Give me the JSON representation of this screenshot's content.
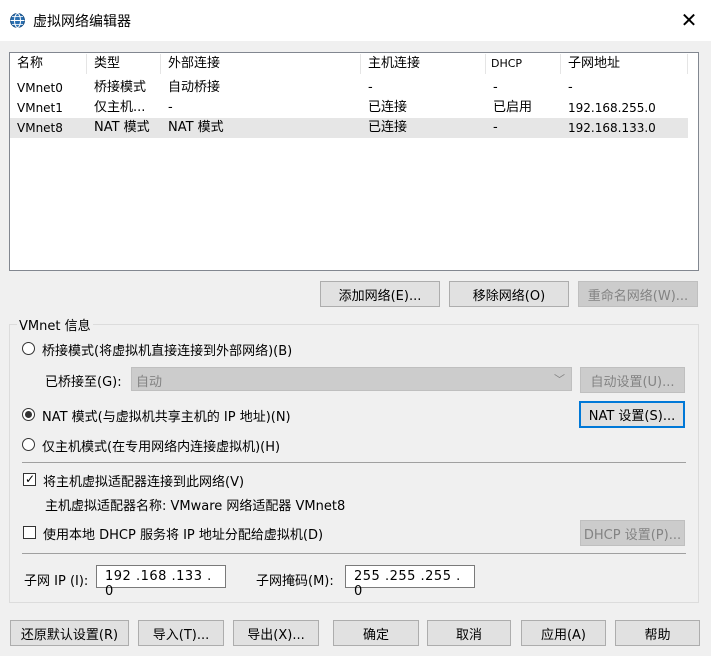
{
  "window": {
    "title": "虚拟网络编辑器",
    "close": "✕"
  },
  "table": {
    "headers": [
      "名称",
      "类型",
      "外部连接",
      "主机连接",
      "DHCP",
      "子网地址"
    ],
    "rows": [
      [
        "VMnet0",
        "桥接模式",
        "自动桥接",
        "-",
        "-",
        "-"
      ],
      [
        "VMnet1",
        "仅主机...",
        "-",
        "已连接",
        "已启用",
        "192.168.255.0"
      ],
      [
        "VMnet8",
        "NAT 模式",
        "NAT 模式",
        "已连接",
        "-",
        "192.168.133.0"
      ]
    ],
    "selected_row": 2
  },
  "network_buttons": {
    "add": "添加网络(E)...",
    "remove": "移除网络(O)",
    "rename": "重命名网络(W)..."
  },
  "vmnet_info": {
    "group_label": "VMnet 信息",
    "bridge_mode": "桥接模式(将虚拟机直接连接到外部网络)(B)",
    "bridged_to_label": "已桥接至(G):",
    "bridged_to_value": "自动",
    "auto_settings": "自动设置(U)...",
    "nat_mode": "NAT 模式(与虚拟机共享主机的 IP 地址)(N)",
    "nat_settings": "NAT 设置(S)...",
    "host_only_mode": "仅主机模式(在专用网络内连接虚拟机)(H)",
    "connect_adapter": "将主机虚拟适配器连接到此网络(V)",
    "adapter_name": "主机虚拟适配器名称: VMware 网络适配器 VMnet8",
    "use_dhcp": "使用本地 DHCP 服务将 IP 地址分配给虚拟机(D)",
    "dhcp_settings": "DHCP 设置(P)...",
    "subnet_ip_label": "子网 IP (I):",
    "subnet_ip_value": "192 .168 .133 .  0",
    "subnet_mask_label": "子网掩码(M):",
    "subnet_mask_value": "255 .255 .255 .  0",
    "selected_mode": "nat",
    "connect_adapter_checked": true,
    "use_dhcp_checked": false
  },
  "footer_buttons": {
    "restore": "还原默认设置(R)",
    "import": "导入(T)...",
    "export": "导出(X)...",
    "ok": "确定",
    "cancel": "取消",
    "apply": "应用(A)",
    "help": "帮助"
  },
  "colors": {
    "accent": "#0078d7",
    "selected_row": "#e6e6e6"
  }
}
